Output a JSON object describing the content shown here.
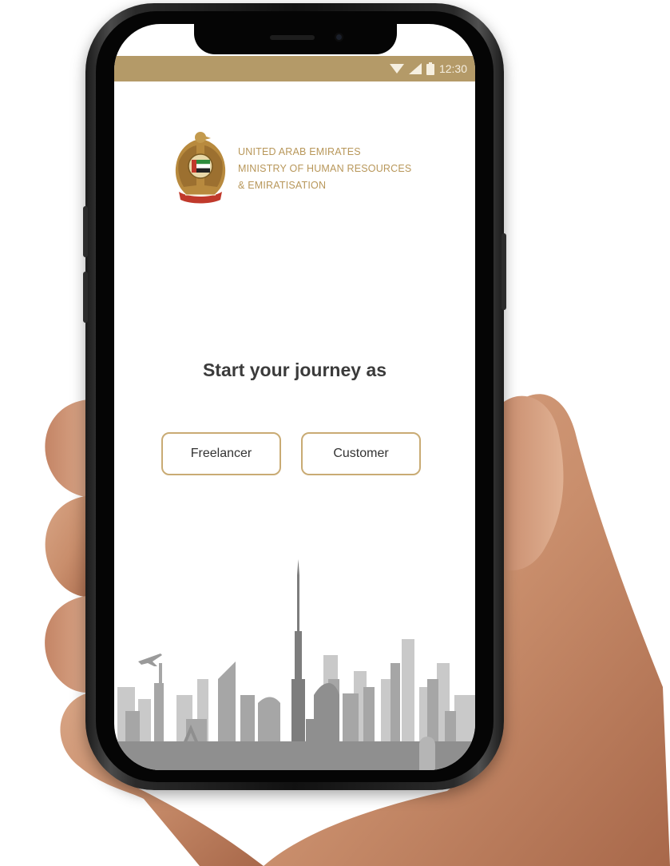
{
  "status_bar": {
    "time": "12:30",
    "icons": [
      "wifi-icon",
      "cellular-signal-icon",
      "battery-icon"
    ],
    "color": "#b49a68"
  },
  "header": {
    "emblem": "uae-coat-of-arms-emblem",
    "lines": [
      "UNITED ARAB EMIRATES",
      "MINISTRY OF HUMAN RESOURCES",
      "& EMIRATISATION"
    ],
    "color": "#b8975a"
  },
  "main": {
    "title": "Start your journey as",
    "buttons": [
      {
        "label": "Freelancer"
      },
      {
        "label": "Customer"
      }
    ],
    "button_border_color": "#c9ab74"
  },
  "footer": {
    "illustration": "dubai-skyline-illustration"
  }
}
